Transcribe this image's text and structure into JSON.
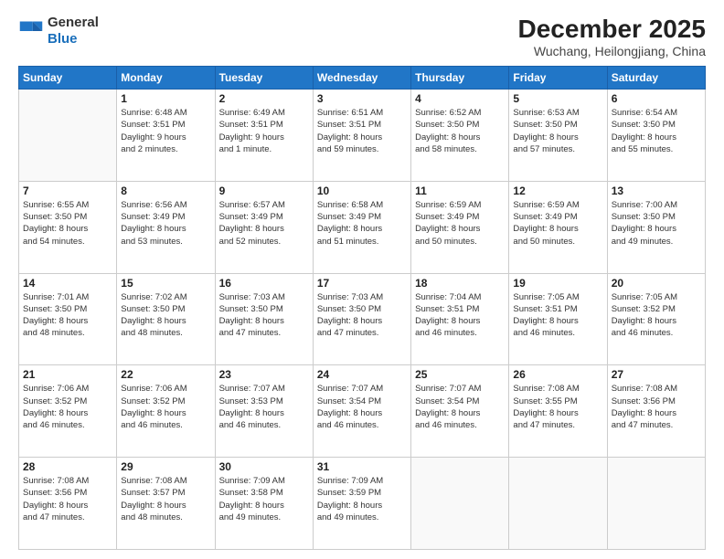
{
  "header": {
    "logo_line1": "General",
    "logo_line2": "Blue",
    "title": "December 2025",
    "subtitle": "Wuchang, Heilongjiang, China"
  },
  "days_of_week": [
    "Sunday",
    "Monday",
    "Tuesday",
    "Wednesday",
    "Thursday",
    "Friday",
    "Saturday"
  ],
  "weeks": [
    [
      {
        "day": "",
        "info": ""
      },
      {
        "day": "1",
        "info": "Sunrise: 6:48 AM\nSunset: 3:51 PM\nDaylight: 9 hours\nand 2 minutes."
      },
      {
        "day": "2",
        "info": "Sunrise: 6:49 AM\nSunset: 3:51 PM\nDaylight: 9 hours\nand 1 minute."
      },
      {
        "day": "3",
        "info": "Sunrise: 6:51 AM\nSunset: 3:51 PM\nDaylight: 8 hours\nand 59 minutes."
      },
      {
        "day": "4",
        "info": "Sunrise: 6:52 AM\nSunset: 3:50 PM\nDaylight: 8 hours\nand 58 minutes."
      },
      {
        "day": "5",
        "info": "Sunrise: 6:53 AM\nSunset: 3:50 PM\nDaylight: 8 hours\nand 57 minutes."
      },
      {
        "day": "6",
        "info": "Sunrise: 6:54 AM\nSunset: 3:50 PM\nDaylight: 8 hours\nand 55 minutes."
      }
    ],
    [
      {
        "day": "7",
        "info": "Sunrise: 6:55 AM\nSunset: 3:50 PM\nDaylight: 8 hours\nand 54 minutes."
      },
      {
        "day": "8",
        "info": "Sunrise: 6:56 AM\nSunset: 3:49 PM\nDaylight: 8 hours\nand 53 minutes."
      },
      {
        "day": "9",
        "info": "Sunrise: 6:57 AM\nSunset: 3:49 PM\nDaylight: 8 hours\nand 52 minutes."
      },
      {
        "day": "10",
        "info": "Sunrise: 6:58 AM\nSunset: 3:49 PM\nDaylight: 8 hours\nand 51 minutes."
      },
      {
        "day": "11",
        "info": "Sunrise: 6:59 AM\nSunset: 3:49 PM\nDaylight: 8 hours\nand 50 minutes."
      },
      {
        "day": "12",
        "info": "Sunrise: 6:59 AM\nSunset: 3:49 PM\nDaylight: 8 hours\nand 50 minutes."
      },
      {
        "day": "13",
        "info": "Sunrise: 7:00 AM\nSunset: 3:50 PM\nDaylight: 8 hours\nand 49 minutes."
      }
    ],
    [
      {
        "day": "14",
        "info": "Sunrise: 7:01 AM\nSunset: 3:50 PM\nDaylight: 8 hours\nand 48 minutes."
      },
      {
        "day": "15",
        "info": "Sunrise: 7:02 AM\nSunset: 3:50 PM\nDaylight: 8 hours\nand 48 minutes."
      },
      {
        "day": "16",
        "info": "Sunrise: 7:03 AM\nSunset: 3:50 PM\nDaylight: 8 hours\nand 47 minutes."
      },
      {
        "day": "17",
        "info": "Sunrise: 7:03 AM\nSunset: 3:50 PM\nDaylight: 8 hours\nand 47 minutes."
      },
      {
        "day": "18",
        "info": "Sunrise: 7:04 AM\nSunset: 3:51 PM\nDaylight: 8 hours\nand 46 minutes."
      },
      {
        "day": "19",
        "info": "Sunrise: 7:05 AM\nSunset: 3:51 PM\nDaylight: 8 hours\nand 46 minutes."
      },
      {
        "day": "20",
        "info": "Sunrise: 7:05 AM\nSunset: 3:52 PM\nDaylight: 8 hours\nand 46 minutes."
      }
    ],
    [
      {
        "day": "21",
        "info": "Sunrise: 7:06 AM\nSunset: 3:52 PM\nDaylight: 8 hours\nand 46 minutes."
      },
      {
        "day": "22",
        "info": "Sunrise: 7:06 AM\nSunset: 3:52 PM\nDaylight: 8 hours\nand 46 minutes."
      },
      {
        "day": "23",
        "info": "Sunrise: 7:07 AM\nSunset: 3:53 PM\nDaylight: 8 hours\nand 46 minutes."
      },
      {
        "day": "24",
        "info": "Sunrise: 7:07 AM\nSunset: 3:54 PM\nDaylight: 8 hours\nand 46 minutes."
      },
      {
        "day": "25",
        "info": "Sunrise: 7:07 AM\nSunset: 3:54 PM\nDaylight: 8 hours\nand 46 minutes."
      },
      {
        "day": "26",
        "info": "Sunrise: 7:08 AM\nSunset: 3:55 PM\nDaylight: 8 hours\nand 47 minutes."
      },
      {
        "day": "27",
        "info": "Sunrise: 7:08 AM\nSunset: 3:56 PM\nDaylight: 8 hours\nand 47 minutes."
      }
    ],
    [
      {
        "day": "28",
        "info": "Sunrise: 7:08 AM\nSunset: 3:56 PM\nDaylight: 8 hours\nand 47 minutes."
      },
      {
        "day": "29",
        "info": "Sunrise: 7:08 AM\nSunset: 3:57 PM\nDaylight: 8 hours\nand 48 minutes."
      },
      {
        "day": "30",
        "info": "Sunrise: 7:09 AM\nSunset: 3:58 PM\nDaylight: 8 hours\nand 49 minutes."
      },
      {
        "day": "31",
        "info": "Sunrise: 7:09 AM\nSunset: 3:59 PM\nDaylight: 8 hours\nand 49 minutes."
      },
      {
        "day": "",
        "info": ""
      },
      {
        "day": "",
        "info": ""
      },
      {
        "day": "",
        "info": ""
      }
    ]
  ]
}
